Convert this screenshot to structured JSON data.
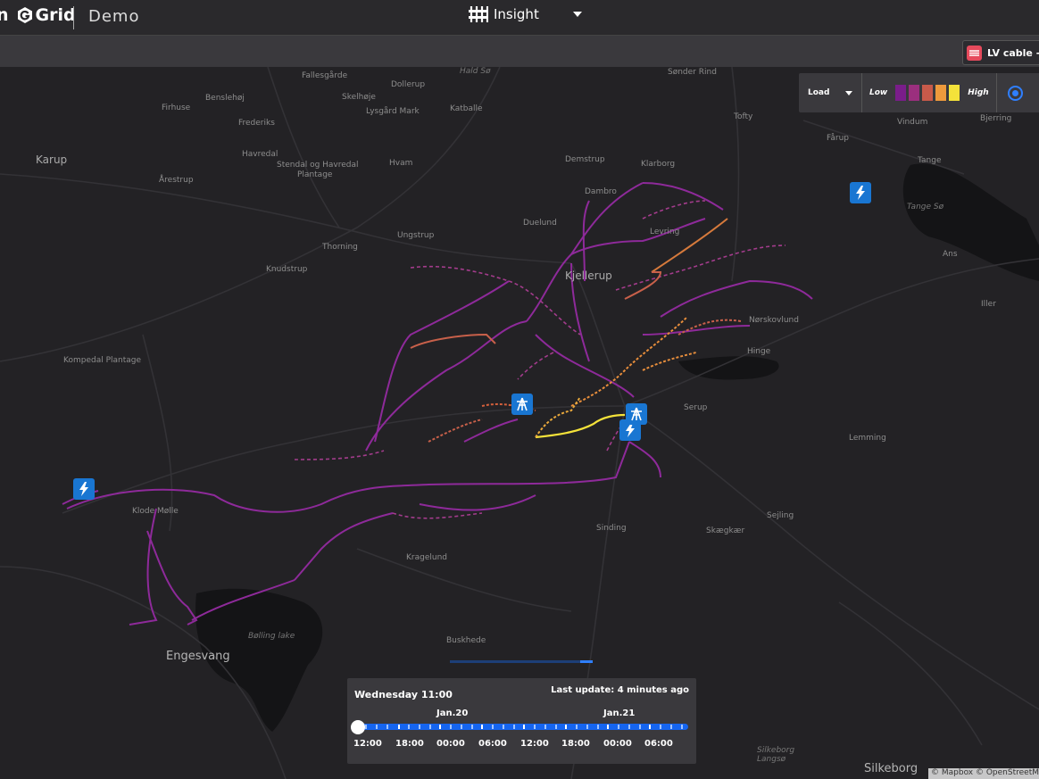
{
  "header": {
    "brand_prefix": "n",
    "brand_name": "Grid",
    "product": "Demo",
    "view_label": "Insight"
  },
  "tab": {
    "label": "LV cable - K"
  },
  "legend": {
    "metric": "Load",
    "low": "Low",
    "high": "High",
    "colors": [
      "#7a1d8a",
      "#9b2f7e",
      "#c85a4a",
      "#ee9a3c",
      "#f4e23a"
    ]
  },
  "places": [
    "Fallesgårde",
    "Hald Sø",
    "Sønder Rind",
    "Benslehøj",
    "Firhuse",
    "Skelhøje",
    "Dollerup",
    "Lysgård Mark",
    "Katballe",
    "Frederiks",
    "Tofty",
    "Vindum",
    "Bjerring",
    "Fårup",
    "Karup",
    "Havredal",
    "Stendal og Havredal",
    "Plantage",
    "Hvam",
    "Demstrup",
    "Klarborg",
    "Tange",
    "Årestrup",
    "Dambro",
    "Tange Sø",
    "Duelund",
    "Levring",
    "Ungstrup",
    "Thorning",
    "Knudstrup",
    "Kjellerup",
    "Ans",
    "Nørskovlund",
    "Iller",
    "Kompedal Plantage",
    "Hinge",
    "Serup",
    "Lemming",
    "Klode Mølle",
    "Sejling",
    "Sinding",
    "Skægkær",
    "Kragelund",
    "Bølling lake",
    "Engesvang",
    "Buskhede",
    "Silkeborg Langsø",
    "Silkeborg"
  ],
  "timeline": {
    "current": "Wednesday 11:00",
    "last_update": "Last update: 4 minutes ago",
    "dates": [
      "Jan.20",
      "Jan.21"
    ],
    "labels": [
      "12:00",
      "18:00",
      "00:00",
      "06:00",
      "12:00",
      "18:00",
      "00:00",
      "06:00"
    ],
    "position_fraction": 0
  },
  "attribution": "© Mapbox © OpenStreetMap"
}
